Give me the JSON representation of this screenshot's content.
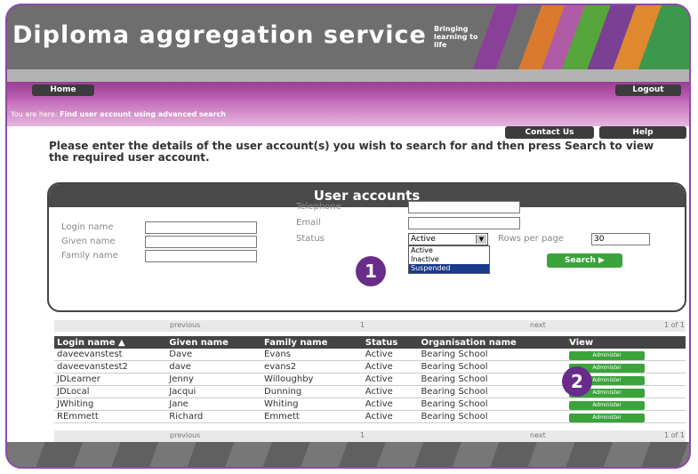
{
  "header": {
    "title": "Diploma aggregation service",
    "tagline": "Bringing learning to life"
  },
  "nav": {
    "home": "Home",
    "logout": "Logout"
  },
  "breadcrumb": {
    "prefix": "You are here:",
    "current": "Find user account using advanced search"
  },
  "top_buttons": {
    "contact": "Contact Us",
    "help": "Help"
  },
  "intro": "Please enter the details of the user account(s) you wish to search for and then press Search to view the required user account.",
  "panel": {
    "title": "User accounts",
    "login_label": "Login name",
    "given_label": "Given name",
    "family_label": "Family name",
    "telephone_label": "Telephone",
    "email_label": "Email",
    "status_label": "Status",
    "status_value": "Active",
    "status_options": [
      "Active",
      "Inactive",
      "Suspended"
    ],
    "rows_label": "Rows per page",
    "rows_value": "30",
    "search_button": "Search"
  },
  "badges": {
    "one": "1",
    "two": "2"
  },
  "pager": {
    "previous": "previous",
    "page": "1",
    "next": "next",
    "of": "1 of 1"
  },
  "table": {
    "headers": [
      "Login name",
      "Given name",
      "Family name",
      "Status",
      "Organisation name",
      "View"
    ],
    "rows": [
      [
        "daveevanstest",
        "Dave",
        "Evans",
        "Active",
        "Bearing School",
        "Administer"
      ],
      [
        "daveevanstest2",
        "dave",
        "evans2",
        "Active",
        "Bearing School",
        "Administer"
      ],
      [
        "JDLearner",
        "Jenny",
        "Willoughby",
        "Active",
        "Bearing School",
        "Administer"
      ],
      [
        "JDLocal",
        "Jacqui",
        "Dunning",
        "Active",
        "Bearing School",
        "Administer"
      ],
      [
        "JWhiting",
        "Jane",
        "Whiting",
        "Active",
        "Bearing School",
        "Administer"
      ],
      [
        "REmmett",
        "Richard",
        "Emmett",
        "Active",
        "Bearing School",
        "Administer"
      ]
    ]
  }
}
